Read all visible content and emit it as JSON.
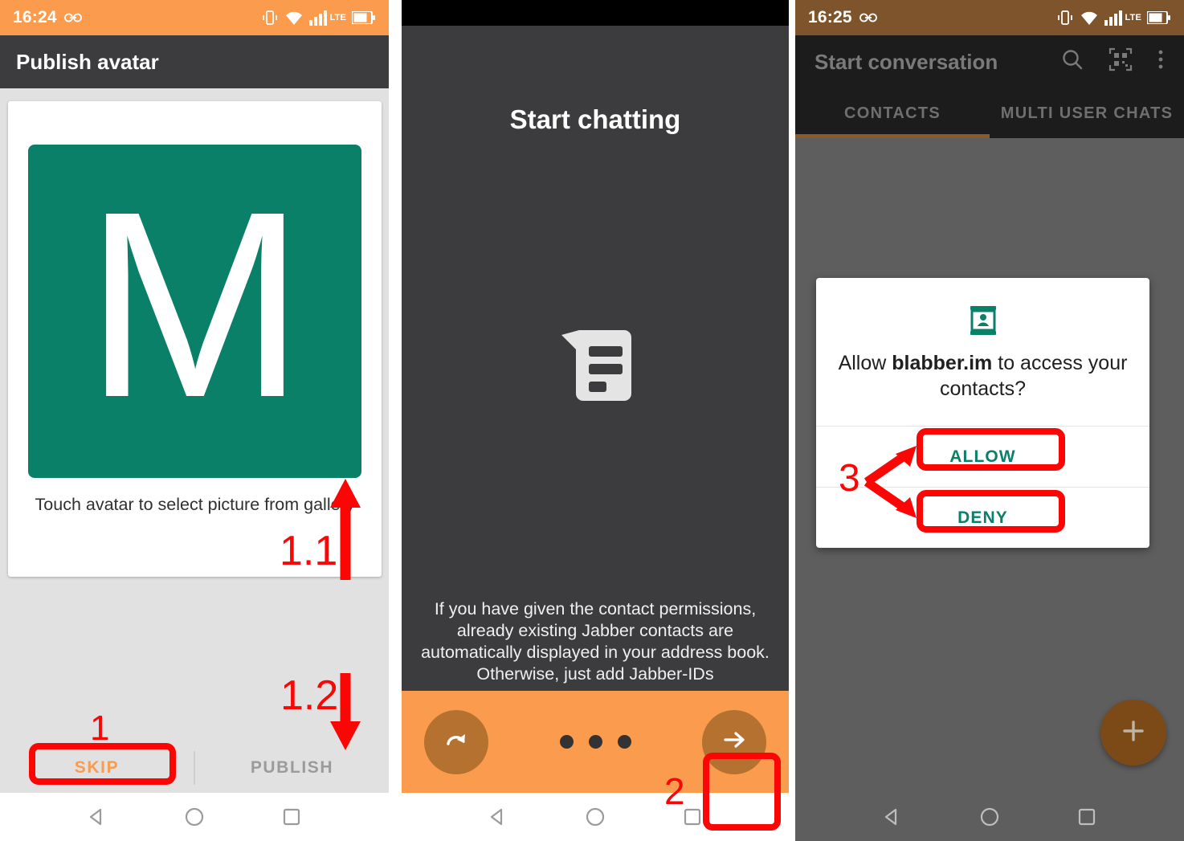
{
  "panel1": {
    "status_bar": {
      "time": "16:24",
      "icons": [
        "link-icon",
        "vibrate-icon",
        "wifi-icon",
        "signal-icon",
        "lte-label",
        "battery-icon"
      ],
      "lte": "LTE",
      "background": "#fa9b4d"
    },
    "appbar_title": "Publish avatar",
    "avatar": {
      "letter": "M",
      "color": "#0a8069"
    },
    "hint": "Touch avatar to select picture from gallery",
    "buttons": {
      "skip": "SKIP",
      "publish": "PUBLISH",
      "skip_color": "#fa9b4d",
      "publish_color": "#9b9b9b"
    },
    "nav": [
      "back-icon",
      "home-icon",
      "recents-icon"
    ]
  },
  "panel2": {
    "title": "Start chatting",
    "icon": "chat-bubble-icon",
    "description": "If you have given the contact permissions, already existing Jabber contacts are automatically displayed in your address book. Otherwise, just add Jabber-IDs",
    "footer": {
      "back_icon": "redo-arrow-icon",
      "next_icon": "arrow-right-icon",
      "dots": 3,
      "background": "#fa9b4d",
      "button_color": "#b5712f"
    },
    "nav": [
      "back-icon",
      "home-icon",
      "recents-icon"
    ]
  },
  "panel3": {
    "status_bar": {
      "time": "16:25",
      "icons": [
        "link-icon",
        "vibrate-icon",
        "wifi-icon",
        "signal-icon",
        "lte-label",
        "battery-icon"
      ],
      "lte": "LTE",
      "background": "#7d542c"
    },
    "appbar_title": "Start conversation",
    "appbar_actions": [
      "search-icon",
      "qr-code-icon",
      "overflow-menu-icon"
    ],
    "tabs": [
      {
        "label": "CONTACTS",
        "selected": true
      },
      {
        "label": "MULTI USER CHATS",
        "selected": false
      }
    ],
    "fab": "add-icon",
    "dialog": {
      "icon": "contacts-permission-icon",
      "message_prefix": "Allow ",
      "app_name": "blabber.im",
      "message_suffix": " to access your contacts?",
      "allow": "ALLOW",
      "deny": "DENY",
      "accent": "#0a8069"
    },
    "nav": [
      "back-icon",
      "home-icon",
      "recents-icon"
    ]
  },
  "annotations": {
    "color": "#fb0505",
    "steps": [
      {
        "id": "1",
        "label": "1",
        "target": "skip-button"
      },
      {
        "id": "1.1",
        "label": "1.1",
        "target": "avatar-tile"
      },
      {
        "id": "1.2",
        "label": "1.2",
        "target": "publish-button"
      },
      {
        "id": "2",
        "label": "2",
        "target": "next-button"
      },
      {
        "id": "3",
        "label": "3",
        "target": "allow-and-deny-buttons"
      }
    ]
  }
}
